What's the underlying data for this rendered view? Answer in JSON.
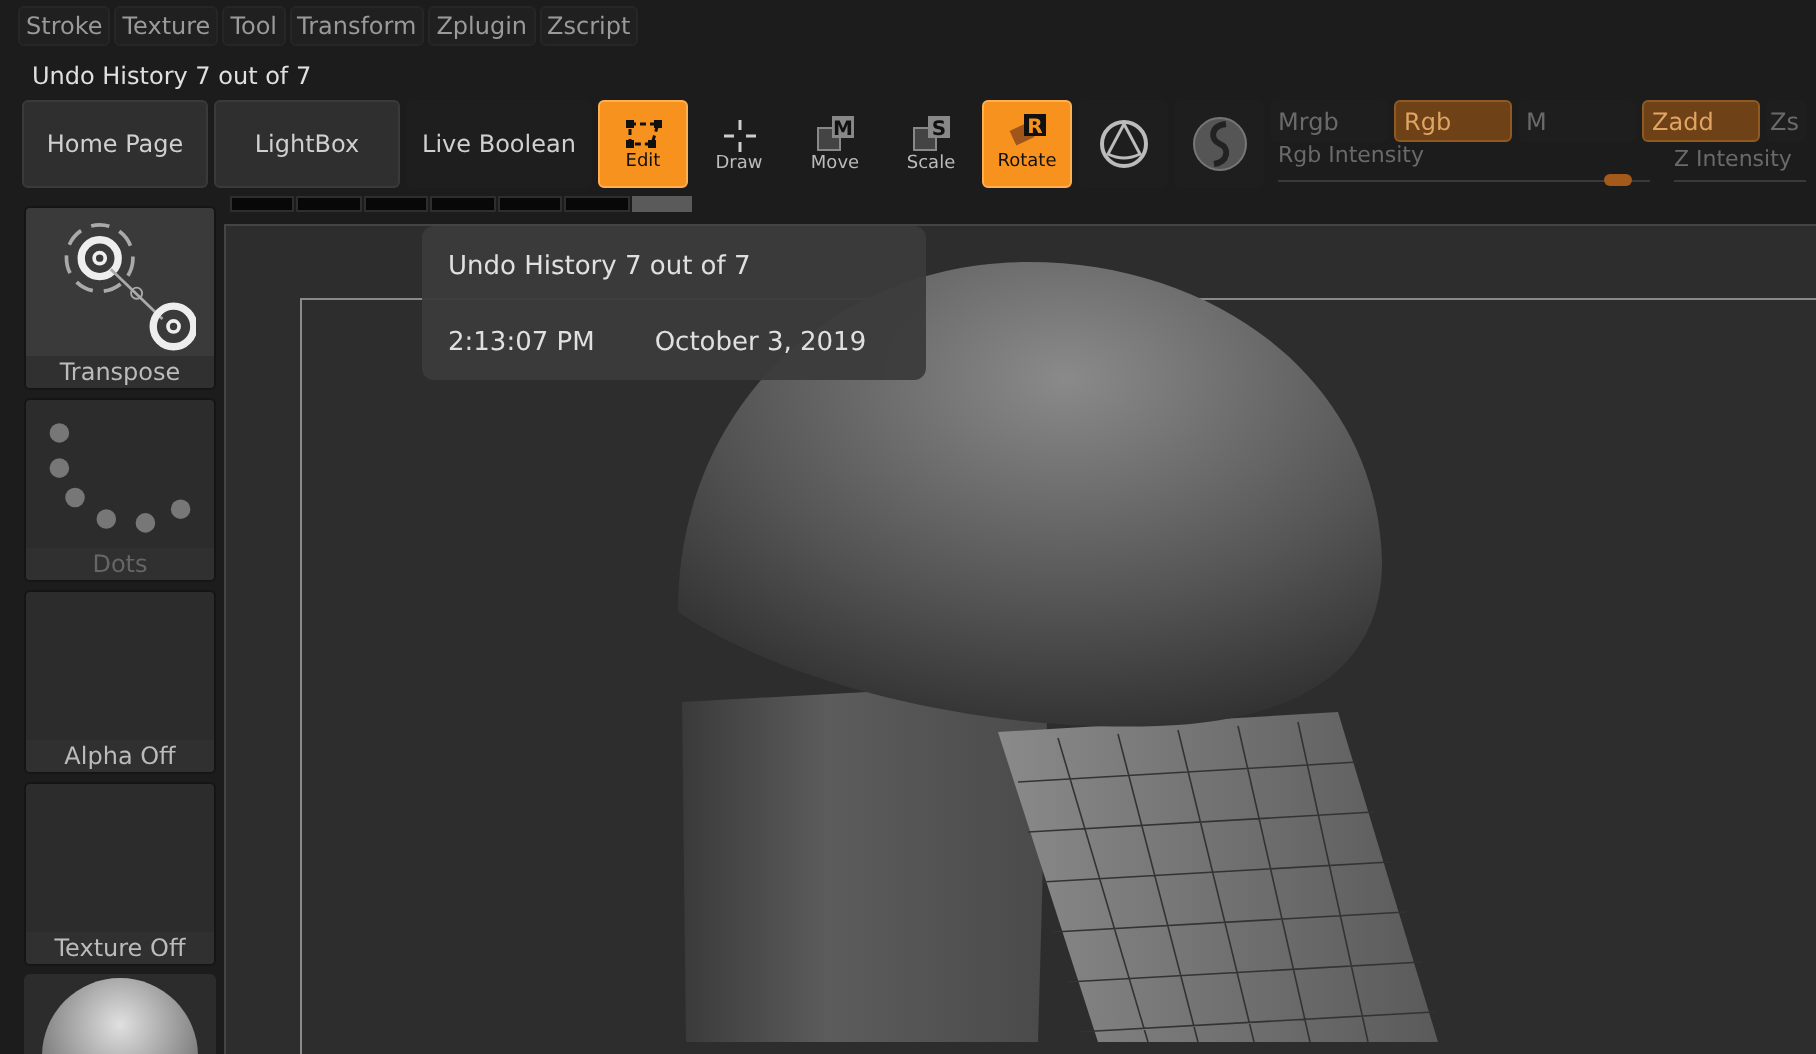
{
  "menu": [
    "Stroke",
    "Texture",
    "Tool",
    "Transform",
    "Zplugin",
    "Zscript"
  ],
  "status_text": "Undo History 7 out of 7",
  "toolbar": [
    {
      "kind": "text",
      "label": "Home Page"
    },
    {
      "kind": "text",
      "label": "LightBox"
    },
    {
      "kind": "text",
      "label": "Live Boolean"
    },
    {
      "kind": "tool",
      "label": "Edit",
      "selected": true
    },
    {
      "kind": "tool",
      "label": "Draw",
      "selected": false
    },
    {
      "kind": "tool",
      "label": "Move",
      "badge": "M",
      "selected": false
    },
    {
      "kind": "tool",
      "label": "Scale",
      "badge": "S",
      "selected": false
    },
    {
      "kind": "tool",
      "label": "Rotate",
      "badge": "R",
      "selected": true
    },
    {
      "kind": "icon"
    },
    {
      "kind": "icon"
    }
  ],
  "modes": [
    {
      "label": "Mrgb",
      "on": false
    },
    {
      "label": "Rgb",
      "on": true
    },
    {
      "label": "M",
      "on": false
    },
    {
      "label": "Zadd",
      "on": true
    },
    {
      "label": "Zs",
      "on": false
    }
  ],
  "rgb_intensity": {
    "label": "Rgb Intensity",
    "level": 0.95
  },
  "z_intensity": {
    "label": "Z Intensity"
  },
  "undo_history": [
    {
      "selected": false
    },
    {
      "selected": false
    },
    {
      "selected": false
    },
    {
      "selected": false
    },
    {
      "selected": false
    },
    {
      "selected": false
    },
    {
      "selected": true
    }
  ],
  "tooltip": {
    "title": "Undo History 7 out of 7",
    "time": "2:13:07 PM",
    "date": "October 3, 2019"
  },
  "left_panel": [
    {
      "kind": "transpose",
      "label": "Transpose"
    },
    {
      "kind": "dots",
      "label": "Dots"
    },
    {
      "kind": "empty",
      "label": "Alpha Off"
    },
    {
      "kind": "empty",
      "label": "Texture Off"
    },
    {
      "kind": "material"
    }
  ]
}
